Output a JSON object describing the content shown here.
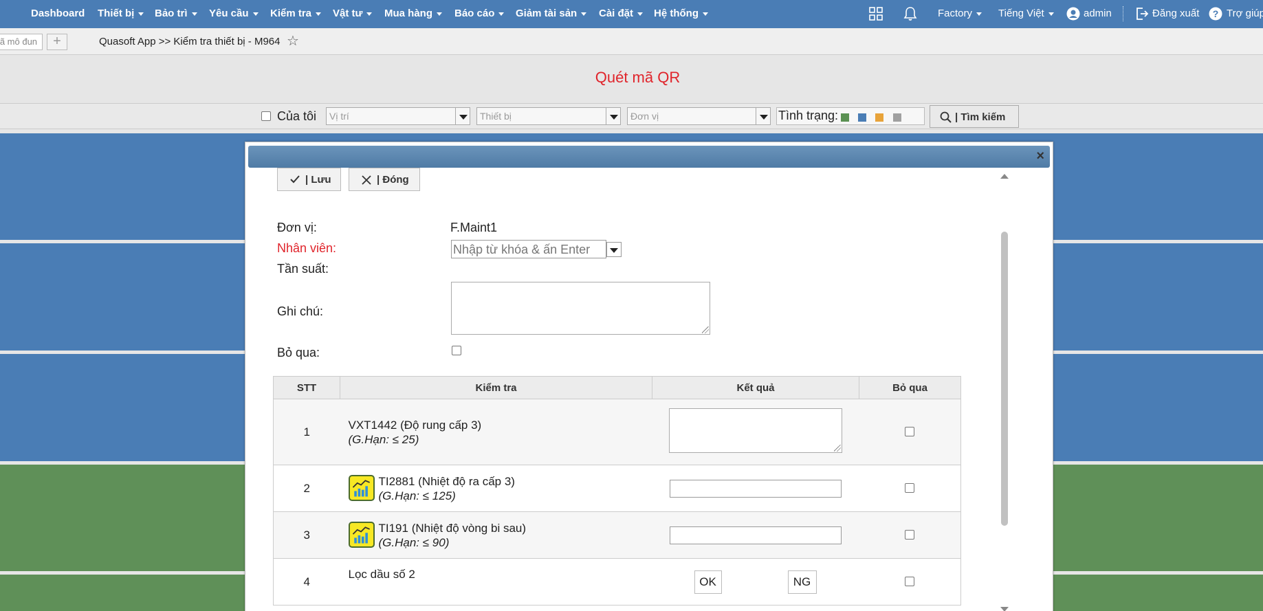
{
  "nav": {
    "items": [
      {
        "label": "Dashboard",
        "caret": false
      },
      {
        "label": "Thiết bị",
        "caret": true
      },
      {
        "label": "Bảo trì",
        "caret": true
      },
      {
        "label": "Yêu cầu",
        "caret": true
      },
      {
        "label": "Kiểm tra",
        "caret": true
      },
      {
        "label": "Vật tư",
        "caret": true
      },
      {
        "label": "Mua hàng",
        "caret": true
      },
      {
        "label": "Báo cáo",
        "caret": true
      },
      {
        "label": "Giảm tài sản",
        "caret": true
      },
      {
        "label": "Cài đặt",
        "caret": true
      },
      {
        "label": "Hệ thống",
        "caret": true
      }
    ],
    "factory": "Factory",
    "language": "Tiếng Việt",
    "user": "admin",
    "logout": "Đăng xuất",
    "help": "Trợ giúp"
  },
  "tabbar": {
    "search_text": "Mã mô đun",
    "add_label": "+",
    "breadcrumb": "Quasoft App >> Kiểm tra thiết bị - M964"
  },
  "page": {
    "title": "Quét mã QR"
  },
  "filter": {
    "mine_label": "Của tôi",
    "location_placeholder": "Vị trí",
    "device_placeholder": "Thiết bị",
    "unit_placeholder": "Đơn vị",
    "status_label": "Tình trạng:",
    "status_colors": [
      "#5b9153",
      "#4a7db5",
      "#e8a33a",
      "#a0a0a0"
    ],
    "search_label": "| Tìm kiếm"
  },
  "background_stripes": [
    "#4a7db5",
    "#4a7db5",
    "#4a7db5",
    "#5f9058",
    "#5f9058"
  ],
  "modal": {
    "save_label": "| Lưu",
    "close_label": "| Đóng",
    "fields": {
      "unit_label": "Đơn vị:",
      "unit_value": "F.Maint1",
      "employee_label": "Nhân viên:",
      "employee_placeholder": "Nhập từ khóa & ấn Enter",
      "frequency_label": "Tần suất:",
      "note_label": "Ghi chú:",
      "skip_label": "Bỏ qua:"
    },
    "table": {
      "headers": [
        "STT",
        "Kiểm tra",
        "Kết quả",
        "Bỏ qua"
      ],
      "rows": [
        {
          "stt": "1",
          "name": "VXT1442 (Độ rung cấp 3)",
          "limit": "(G.Hạn: ≤ 25)"
        },
        {
          "stt": "2",
          "name": "TI2881 (Nhiệt độ ra cấp 3)",
          "limit": "(G.Hạn: ≤ 125)"
        },
        {
          "stt": "3",
          "name": "TI191 (Nhiệt độ vòng bi sau)",
          "limit": "(G.Hạn: ≤ 90)"
        },
        {
          "stt": "4",
          "name": "Lọc dầu số 2",
          "ok": "OK",
          "ng": "NG"
        }
      ]
    }
  }
}
